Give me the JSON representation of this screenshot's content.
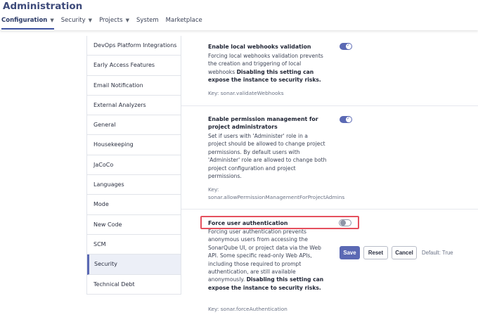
{
  "header": {
    "title": "Administration",
    "nav": [
      {
        "label": "Configuration",
        "caret": true
      },
      {
        "label": "Security",
        "caret": true
      },
      {
        "label": "Projects",
        "caret": true
      },
      {
        "label": "System",
        "caret": false
      },
      {
        "label": "Marketplace",
        "caret": false
      }
    ]
  },
  "sidebar": {
    "items": [
      {
        "label": "DevOps Platform Integrations"
      },
      {
        "label": "Early Access Features"
      },
      {
        "label": "Email Notification"
      },
      {
        "label": "External Analyzers"
      },
      {
        "label": "General"
      },
      {
        "label": "Housekeeping"
      },
      {
        "label": "JaCoCo"
      },
      {
        "label": "Languages"
      },
      {
        "label": "Mode"
      },
      {
        "label": "New Code"
      },
      {
        "label": "SCM"
      },
      {
        "label": "Security"
      },
      {
        "label": "Technical Debt"
      }
    ],
    "active": "Security"
  },
  "settings": {
    "webhooks": {
      "title": "Enable local webhooks validation",
      "desc": "Forcing local webhooks validation prevents the creation and triggering of local webhooks",
      "warning": "Disabling this setting can expose the instance to security risks.",
      "key": "Key: sonar.validateWebhooks",
      "enabled": true
    },
    "permissions": {
      "title": "Enable permission management for project administrators",
      "desc": "Set if users with 'Administer' role in a project should be allowed to change project permissions. By default users with 'Administer' role are allowed to change both project configuration and project permissions.",
      "key_label": "Key:",
      "key_value": "sonar.allowPermissionManagementForProjectAdmins",
      "enabled": true
    },
    "force_auth": {
      "title": "Force user authentication",
      "desc": "Forcing user authentication prevents anonymous users from accessing the SonarQube UI, or project data via the Web API. Some specific read-only Web APIs, including those required to prompt authentication, are still available anonymously.",
      "warning": "Disabling this setting can expose the instance to security risks.",
      "key": "Key: sonar.forceAuthentication",
      "enabled": false,
      "save_label": "Save",
      "reset_label": "Reset",
      "cancel_label": "Cancel",
      "default_label": "Default: True"
    }
  },
  "colors": {
    "accent": "#5b69b4",
    "highlight": "#e5505e",
    "title": "#3d4a7a"
  }
}
